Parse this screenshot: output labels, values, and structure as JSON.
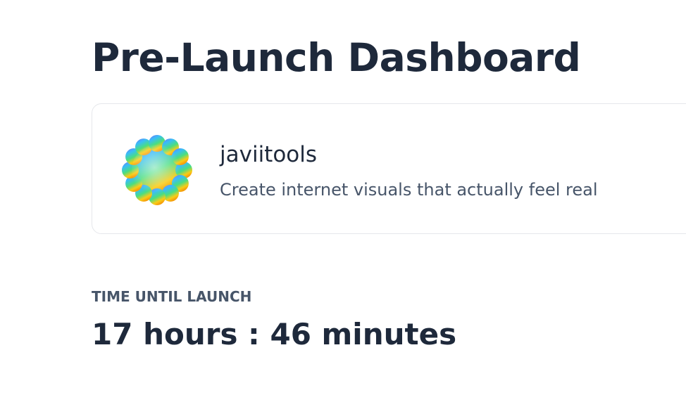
{
  "page": {
    "title": "Pre-Launch Dashboard"
  },
  "product": {
    "logo_icon": "flower-gradient-icon",
    "name": "javiitools",
    "tagline": "Create internet visuals that actually feel real"
  },
  "countdown": {
    "label": "TIME UNTIL LAUNCH",
    "value": "17 hours : 46 minutes"
  },
  "colors": {
    "text_primary": "#1e293b",
    "text_secondary": "#475569",
    "card_border": "#e5e7eb",
    "logo_gradient": [
      "#7c6cf0",
      "#38bdf8",
      "#4ade80",
      "#facc15",
      "#f59e0b"
    ]
  }
}
